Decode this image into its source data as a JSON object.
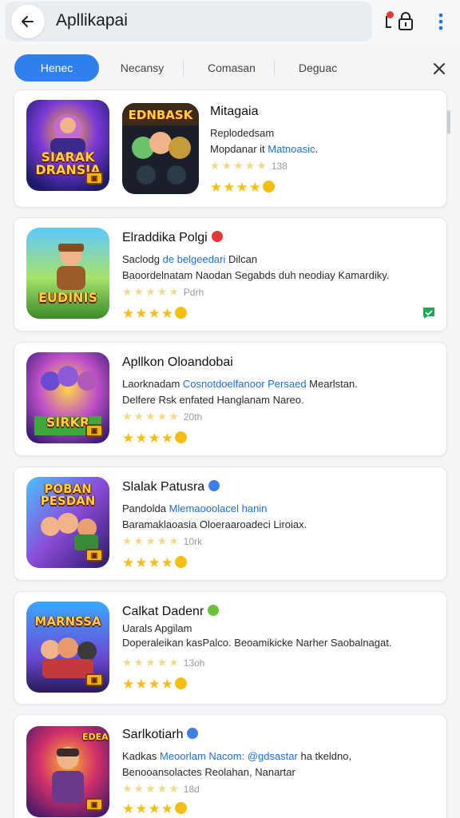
{
  "header": {
    "title": "Apllikapai",
    "back_icon": "arrow-left-icon",
    "lock_icon": "lock-icon",
    "more_icon": "more-vertical-icon"
  },
  "tabs": [
    {
      "label": "Henec",
      "active": true
    },
    {
      "label": "Necansy",
      "active": false
    },
    {
      "label": "Comasan",
      "active": false
    },
    {
      "label": "Deguac",
      "active": false
    }
  ],
  "apps": [
    {
      "thumb_text": "SIARAK DRANSIA",
      "thumb2_text": "EDNBASK",
      "title": "Mitagaia",
      "line1": "Replodedsam",
      "line2_prefix": "Mopdanar it ",
      "line2_link": "Matnoasic",
      "line2_suffix": ".",
      "count": "138",
      "rating": 4
    },
    {
      "thumb_text": "EUDINIS",
      "title": "Elraddika Polgi",
      "line1_prefix": "Saclodg ",
      "line1_link": "de belgeedari",
      "line1_suffix": " Dilcan",
      "line2": "Baoordelnatam Naodan Segabds duh neodiay Kamardiky.",
      "count": "Pdrh",
      "rating": 4
    },
    {
      "thumb_text": "SIRKR",
      "title": "Apllkon Oloandobai",
      "line1_prefix": "Laorknadam ",
      "line1_link": "Cosnotdoelfanoor Persaed",
      "line1_suffix": " Mearlstan.",
      "line2": "Delfere Rsk enfated Hanglanam Nareo.",
      "count": "20th",
      "rating": 4
    },
    {
      "thumb_text": "POBAN PESDAN",
      "title": "Slalak Patusra",
      "line1_prefix": "Pandolda ",
      "line1_link": "Mlemaooolacel hanin",
      "line1_suffix": "",
      "line2": "Baramaklaoasia Oloeraaroadeci Liroiax.",
      "count": "10rk",
      "rating": 4
    },
    {
      "thumb_text": "MARNSSA",
      "title": "Calkat Dadenr",
      "line1": "Uarals Apgilam",
      "line2": "Doperaleikan kasPalco. Beoamikicke Narher Saobalnagat.",
      "count": "13oh",
      "rating": 4
    },
    {
      "thumb_text": "EDEA",
      "title": "Sarlkotiarh",
      "line1_prefix": "Kadkas ",
      "line1_link": "Meoorlam Nacom: @gdsastar",
      "line1_suffix": " ha tkeldno,",
      "line2": "Benooansolactes Reolahan, Nanartar",
      "count": "18d",
      "rating": 4
    }
  ]
}
